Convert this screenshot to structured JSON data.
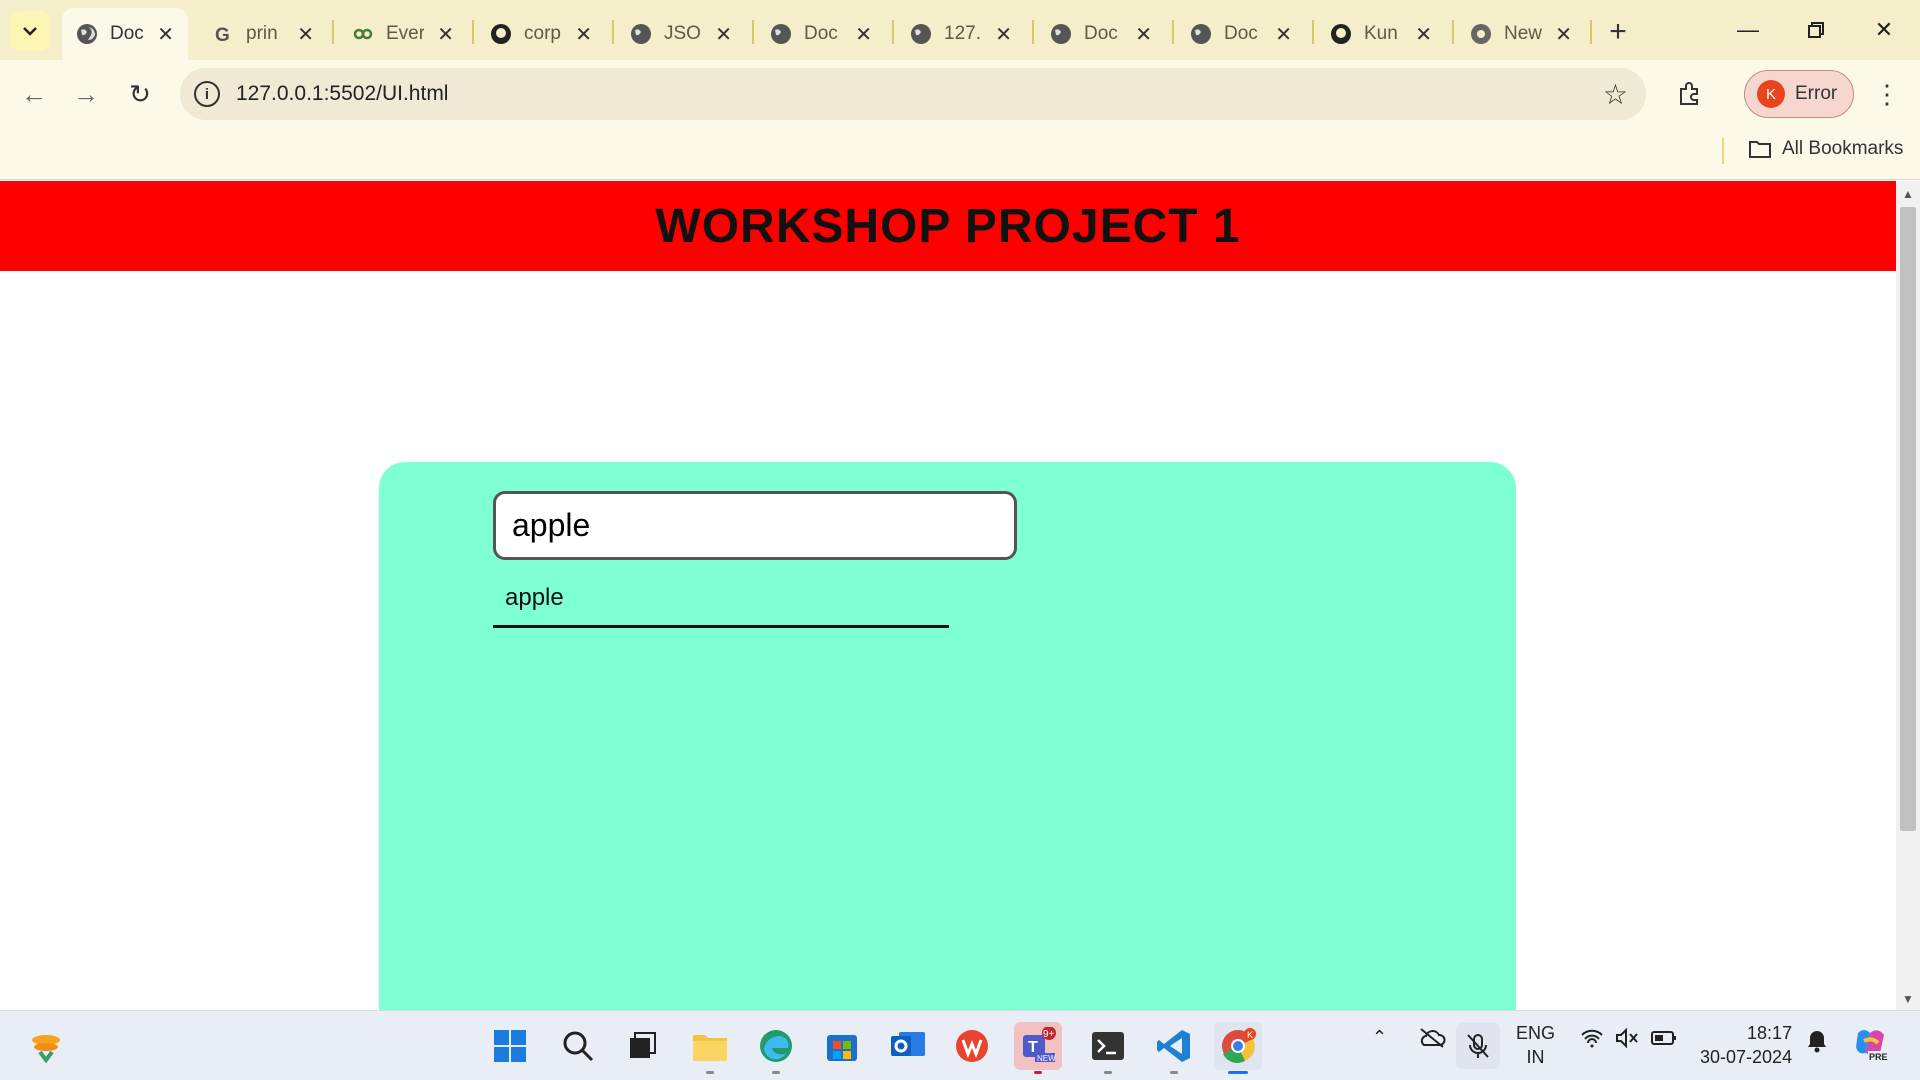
{
  "browser": {
    "tabs": [
      {
        "title": "Doc",
        "active": true
      },
      {
        "title": "prin",
        "active": false
      },
      {
        "title": "Ever",
        "active": false
      },
      {
        "title": "corp",
        "active": false
      },
      {
        "title": "JSOI",
        "active": false
      },
      {
        "title": "Doc",
        "active": false
      },
      {
        "title": "127.",
        "active": false
      },
      {
        "title": "Doc",
        "active": false
      },
      {
        "title": "Doc",
        "active": false
      },
      {
        "title": "Kun",
        "active": false
      },
      {
        "title": "New",
        "active": false
      }
    ],
    "url": "127.0.0.1:5502/UI.html",
    "profile": {
      "initial": "K",
      "label": "Error"
    },
    "bookmarks_label": "All Bookmarks"
  },
  "page": {
    "header_title": "WORKSHOP PROJECT 1",
    "search_value": "apple",
    "suggestion": "apple",
    "colors": {
      "header": "#ff0000",
      "panel": "#7fffd4"
    }
  },
  "taskbar": {
    "language": {
      "line1": "ENG",
      "line2": "IN"
    },
    "time": "18:17",
    "date": "30-07-2024",
    "teams_badge": "9+",
    "new_label": "NEW",
    "pre_label": "PRE"
  }
}
